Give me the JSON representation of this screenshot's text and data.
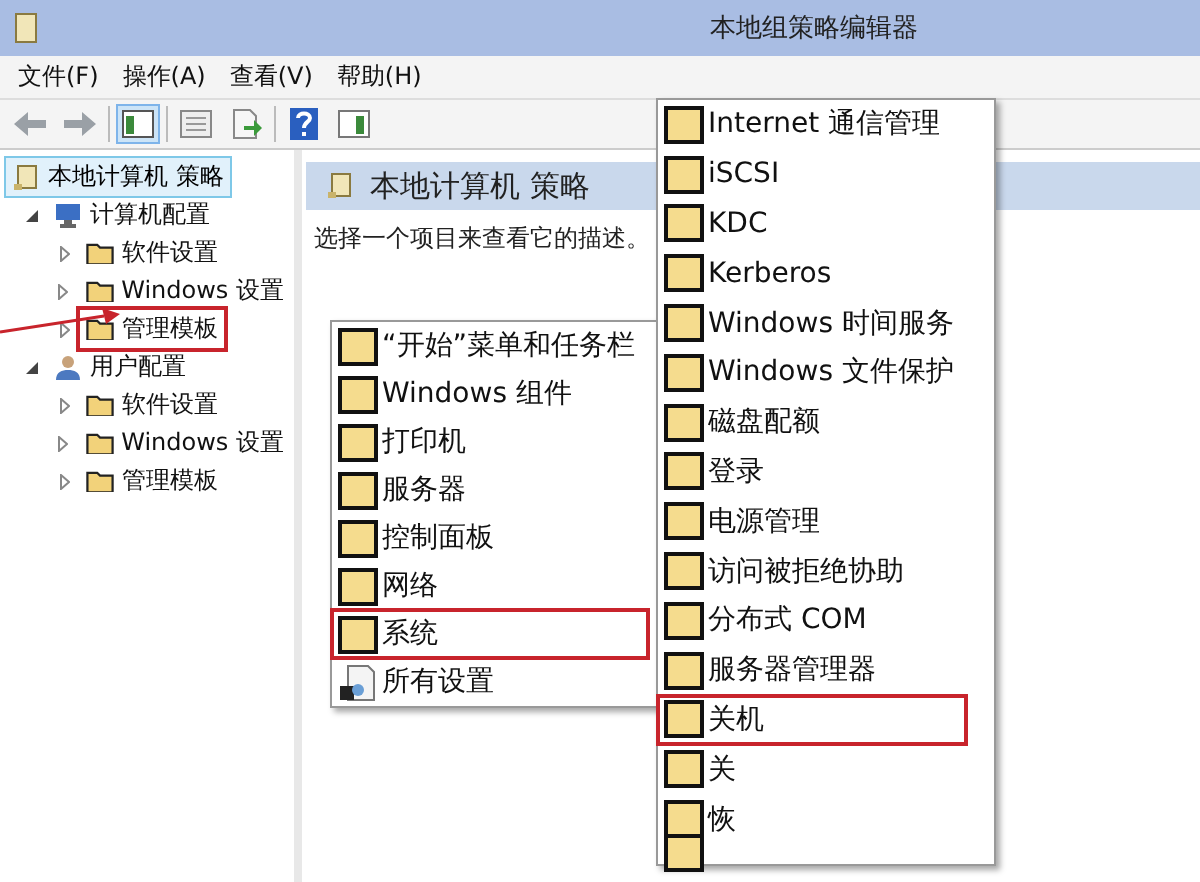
{
  "window": {
    "title": "本地组策略编辑器"
  },
  "menu_bar": [
    "文件(F)",
    "操作(A)",
    "查看(V)",
    "帮助(H)"
  ],
  "toolbar": [
    {
      "kind": "back",
      "pressed": false
    },
    {
      "kind": "forward",
      "pressed": false
    },
    {
      "kind": "separator"
    },
    {
      "kind": "tree-toggle",
      "pressed": true
    },
    {
      "kind": "separator"
    },
    {
      "kind": "properties",
      "pressed": false
    },
    {
      "kind": "export",
      "pressed": false
    },
    {
      "kind": "separator"
    },
    {
      "kind": "help",
      "pressed": false
    },
    {
      "kind": "pane-toggle",
      "pressed": false
    }
  ],
  "tree": {
    "label": "本地计算机 策略",
    "selected": true,
    "children": [
      {
        "label": "计算机配置",
        "kind": "computer",
        "expanded": true,
        "highlighted": false,
        "children": [
          {
            "label": "软件设置",
            "kind": "folder",
            "expanded": false,
            "highlighted": false
          },
          {
            "label": "Windows 设置",
            "kind": "folder",
            "expanded": false,
            "highlighted": false
          },
          {
            "label": "管理模板",
            "kind": "folder",
            "expanded": false,
            "highlighted": true
          }
        ]
      },
      {
        "label": "用户配置",
        "kind": "user",
        "expanded": true,
        "highlighted": false,
        "children": [
          {
            "label": "软件设置",
            "kind": "folder",
            "expanded": false,
            "highlighted": false
          },
          {
            "label": "Windows 设置",
            "kind": "folder",
            "expanded": false,
            "highlighted": false
          },
          {
            "label": "管理模板",
            "kind": "folder",
            "expanded": false,
            "highlighted": false
          }
        ]
      }
    ]
  },
  "content": {
    "title": "本地计算机 策略",
    "description": "选择一个项目来查看它的描述。"
  },
  "menus": [
    {
      "items": [
        {
          "label": "“开始”菜单和任务栏",
          "kind": "folder",
          "highlighted": false
        },
        {
          "label": "Windows 组件",
          "kind": "folder",
          "highlighted": false
        },
        {
          "label": "打印机",
          "kind": "folder",
          "highlighted": false
        },
        {
          "label": "服务器",
          "kind": "folder",
          "highlighted": false
        },
        {
          "label": "控制面板",
          "kind": "folder",
          "highlighted": false
        },
        {
          "label": "网络",
          "kind": "folder",
          "highlighted": false
        },
        {
          "label": "系统",
          "kind": "folder",
          "highlighted": true
        },
        {
          "label": "所有设置",
          "kind": "settings",
          "highlighted": false
        }
      ]
    },
    {
      "items": [
        {
          "label": "Internet 通信管理",
          "kind": "folder",
          "highlighted": false
        },
        {
          "label": "iSCSI",
          "kind": "folder",
          "highlighted": false
        },
        {
          "label": "KDC",
          "kind": "folder",
          "highlighted": false
        },
        {
          "label": "Kerberos",
          "kind": "folder",
          "highlighted": false
        },
        {
          "label": "Windows 时间服务",
          "kind": "folder",
          "highlighted": false
        },
        {
          "label": "Windows 文件保护",
          "kind": "folder",
          "highlighted": false
        },
        {
          "label": "磁盘配额",
          "kind": "folder",
          "highlighted": false
        },
        {
          "label": "登录",
          "kind": "folder",
          "highlighted": false
        },
        {
          "label": "电源管理",
          "kind": "folder",
          "highlighted": false
        },
        {
          "label": "访问被拒绝协助",
          "kind": "folder",
          "highlighted": false
        },
        {
          "label": "分布式 COM",
          "kind": "folder",
          "highlighted": false
        },
        {
          "label": "服务器管理器",
          "kind": "folder",
          "highlighted": false
        },
        {
          "label": "关机",
          "kind": "folder",
          "highlighted": true
        },
        {
          "label": "关",
          "kind": "folder",
          "highlighted": false
        },
        {
          "label": "恢",
          "kind": "folder",
          "highlighted": false
        }
      ]
    }
  ]
}
